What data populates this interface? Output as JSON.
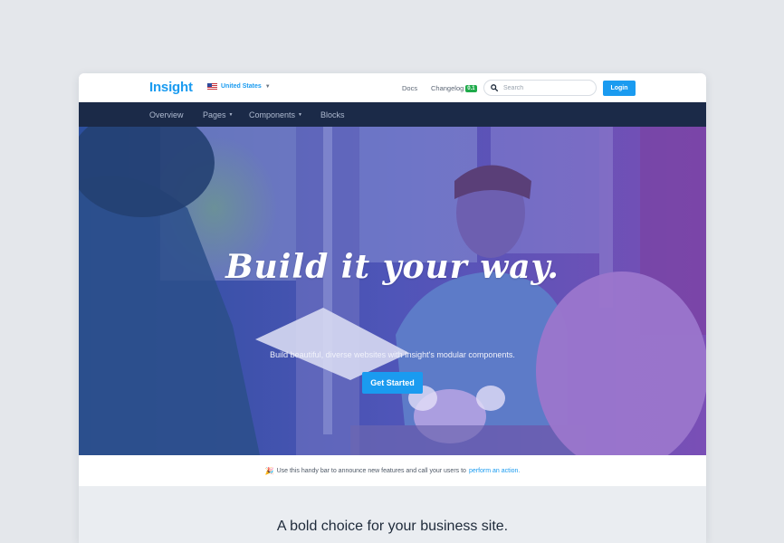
{
  "header": {
    "logo": "Insight",
    "locale": "United States",
    "docs_label": "Docs",
    "changelog_label": "Changelog",
    "changelog_badge": "0.1",
    "search_placeholder": "Search",
    "login_label": "Login"
  },
  "nav": {
    "items": [
      {
        "label": "Overview",
        "has_dropdown": false
      },
      {
        "label": "Pages",
        "has_dropdown": true
      },
      {
        "label": "Components",
        "has_dropdown": true
      },
      {
        "label": "Blocks",
        "has_dropdown": false
      }
    ]
  },
  "hero": {
    "title": "Build it your way.",
    "subtitle": "Build beautiful, diverse websites with Insight's modular components.",
    "cta_label": "Get Started"
  },
  "announcement": {
    "emoji": "🎉",
    "text": "Use this handy bar to announce new features and call your users to",
    "link_text": "perform an action."
  },
  "section": {
    "title": "A bold choice for your business site."
  },
  "colors": {
    "accent": "#1a9bf0",
    "navbar": "#1b2a48",
    "hero_overlay": "#4a4fb0",
    "badge": "#1faa4a"
  }
}
